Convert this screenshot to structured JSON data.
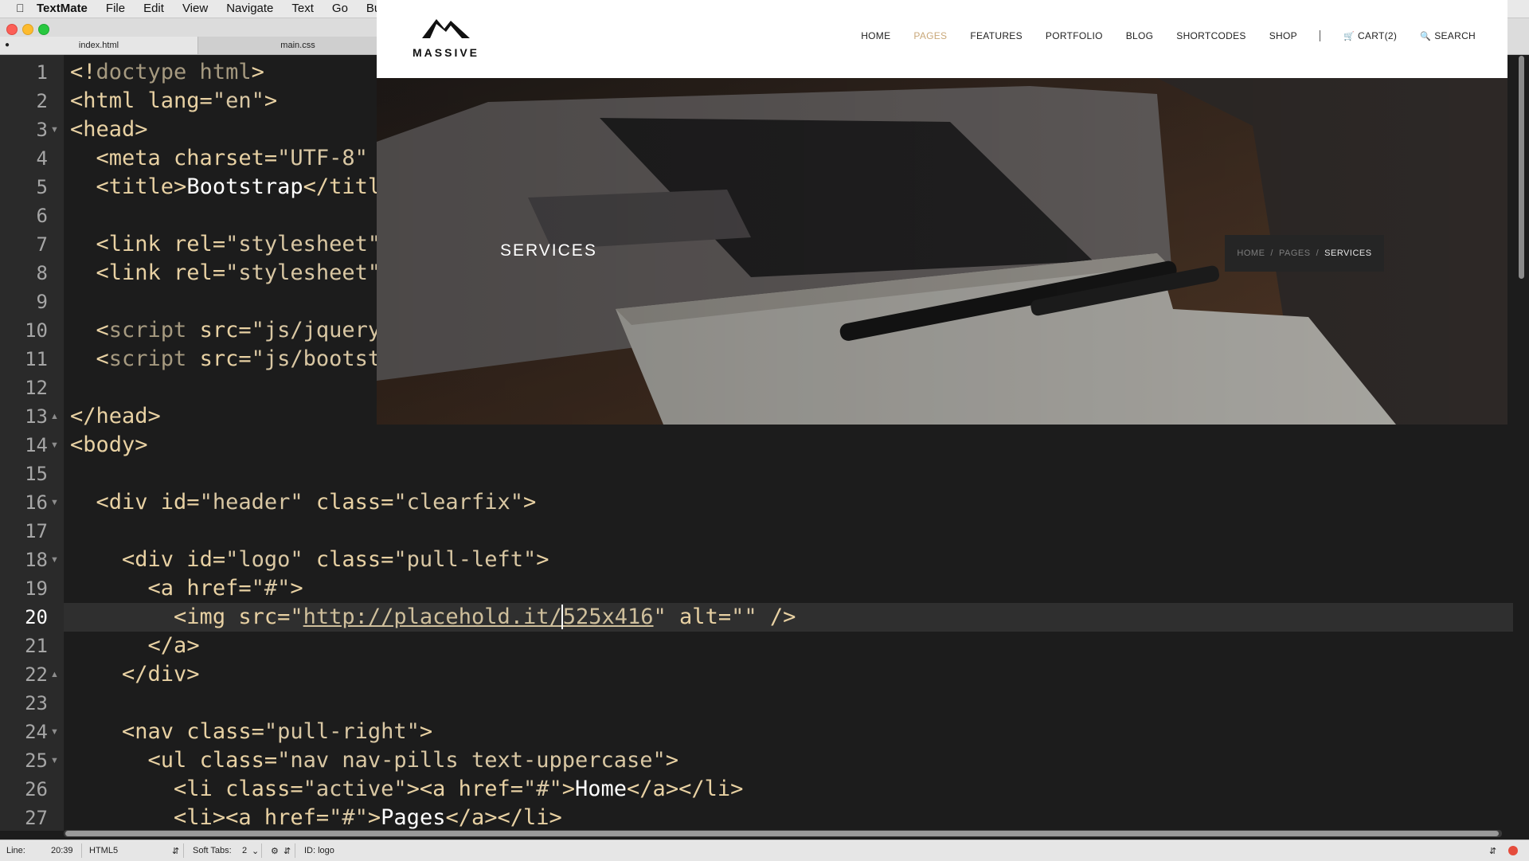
{
  "menubar": {
    "items": [
      "TextMate",
      "File",
      "Edit",
      "View",
      "Navigate",
      "Text",
      "Go",
      "Bundle"
    ]
  },
  "tabs": [
    {
      "label": "index.html",
      "active": true,
      "modified": true
    },
    {
      "label": "main.css",
      "active": false
    }
  ],
  "editor": {
    "current_line": 20,
    "lines": [
      {
        "n": "1",
        "fold": "",
        "html": "<span class='tag'>&lt;!</span><span class='kw'>doctype html</span><span class='tag'>&gt;</span>"
      },
      {
        "n": "2",
        "fold": "",
        "html": "<span class='tag'>&lt;html lang=</span><span class='str'>\"en\"</span><span class='tag'>&gt;</span>"
      },
      {
        "n": "3",
        "fold": "▼",
        "html": "<span class='tag'>&lt;head&gt;</span>"
      },
      {
        "n": "4",
        "fold": "",
        "html": "  <span class='tag'>&lt;meta charset=</span><span class='str'>\"UTF-8\"</span>"
      },
      {
        "n": "5",
        "fold": "",
        "html": "  <span class='tag'>&lt;title&gt;</span><span class='plain'>Bootstrap</span><span class='tag'>&lt;/title&gt;</span>"
      },
      {
        "n": "6",
        "fold": "",
        "html": ""
      },
      {
        "n": "7",
        "fold": "",
        "html": "  <span class='tag'>&lt;link rel=</span><span class='str'>\"stylesheet\"</span>"
      },
      {
        "n": "8",
        "fold": "",
        "html": "  <span class='tag'>&lt;link rel=</span><span class='str'>\"stylesheet\"</span>"
      },
      {
        "n": "9",
        "fold": "",
        "html": ""
      },
      {
        "n": "10",
        "fold": "",
        "html": "  <span class='tag'>&lt;</span><span class='kw'>script</span><span class='tag'> src=</span><span class='str'>\"js/jquery\"</span>"
      },
      {
        "n": "11",
        "fold": "",
        "html": "  <span class='tag'>&lt;</span><span class='kw'>script</span><span class='tag'> src=</span><span class='str'>\"js/bootstrap\"</span>"
      },
      {
        "n": "12",
        "fold": "",
        "html": ""
      },
      {
        "n": "13",
        "fold": "▲",
        "html": "<span class='tag'>&lt;/head&gt;</span>"
      },
      {
        "n": "14",
        "fold": "▼",
        "html": "<span class='tag'>&lt;body&gt;</span>"
      },
      {
        "n": "15",
        "fold": "",
        "html": ""
      },
      {
        "n": "16",
        "fold": "▼",
        "html": "  <span class='tag'>&lt;div id=</span><span class='str'>\"header\"</span><span class='tag'> class=</span><span class='str'>\"clearfix\"</span><span class='tag'>&gt;</span>"
      },
      {
        "n": "17",
        "fold": "",
        "html": ""
      },
      {
        "n": "18",
        "fold": "▼",
        "html": "    <span class='tag'>&lt;div id=</span><span class='str'>\"logo\"</span><span class='tag'> class=</span><span class='str'>\"pull-left\"</span><span class='tag'>&gt;</span>"
      },
      {
        "n": "19",
        "fold": "",
        "html": "      <span class='tag'>&lt;a href=</span><span class='str'>\"#\"</span><span class='tag'>&gt;</span>"
      },
      {
        "n": "20",
        "fold": "",
        "html": "        <span class='tag'>&lt;img src=</span><span class='str'>\"</span><span class='url'>http://placehold.it/<span class='caret'></span>525x416</span><span class='str'>\"</span><span class='tag'> alt=</span><span class='str'>\"\"</span><span class='tag'> /&gt;</span>"
      },
      {
        "n": "21",
        "fold": "",
        "html": "      <span class='tag'>&lt;/a&gt;</span>"
      },
      {
        "n": "22",
        "fold": "▲",
        "html": "    <span class='tag'>&lt;/div&gt;</span>"
      },
      {
        "n": "23",
        "fold": "",
        "html": ""
      },
      {
        "n": "24",
        "fold": "▼",
        "html": "    <span class='tag'>&lt;nav class=</span><span class='str'>\"pull-right\"</span><span class='tag'>&gt;</span>"
      },
      {
        "n": "25",
        "fold": "▼",
        "html": "      <span class='tag'>&lt;ul class=</span><span class='str'>\"nav nav-pills text-uppercase\"</span><span class='tag'>&gt;</span>"
      },
      {
        "n": "26",
        "fold": "",
        "html": "        <span class='tag'>&lt;li class=</span><span class='str'>\"active\"</span><span class='tag'>&gt;&lt;a href=</span><span class='str'>\"#\"</span><span class='tag'>&gt;</span><span class='plain'>Home</span><span class='tag'>&lt;/a&gt;&lt;/li&gt;</span>"
      },
      {
        "n": "27",
        "fold": "",
        "html": "        <span class='tag'>&lt;li&gt;&lt;a href=</span><span class='str'>\"#\"</span><span class='tag'>&gt;</span><span class='plain'>Pages</span><span class='tag'>&lt;/a&gt;&lt;/li&gt;</span>"
      }
    ]
  },
  "statusbar": {
    "line_label": "Line:",
    "line_value": "20:39",
    "language": "HTML5",
    "tabs_label": "Soft Tabs:",
    "tabs_value": "2",
    "symbol": "ID: logo"
  },
  "preview": {
    "logo_text": "MASSIVE",
    "nav": [
      "HOME",
      "PAGES",
      "FEATURES",
      "PORTFOLIO",
      "BLOG",
      "SHORTCODES",
      "SHOP"
    ],
    "active_nav": "PAGES",
    "cart": "CART(2)",
    "search": "SEARCH",
    "hero_title": "SERVICES",
    "breadcrumb": [
      "HOME",
      "PAGES",
      "SERVICES"
    ],
    "accent_color": "#c9a87a"
  }
}
